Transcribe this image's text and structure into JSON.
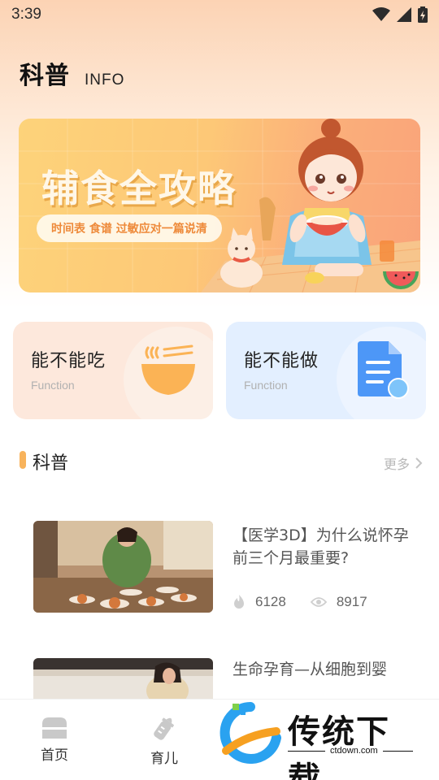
{
  "status": {
    "time": "3:39"
  },
  "header": {
    "title": "科普",
    "subtitle": "INFO"
  },
  "banner": {
    "title": "辅食全攻略",
    "tagline": "时间表 食谱 过敏应对一篇说清"
  },
  "cards": [
    {
      "title": "能不能吃",
      "subtitle": "Function",
      "icon": "noodle-bowl-icon"
    },
    {
      "title": "能不能做",
      "subtitle": "Function",
      "icon": "document-icon"
    }
  ],
  "section": {
    "title": "科普",
    "more": "更多"
  },
  "articles": [
    {
      "title": "【医学3D】为什么说怀孕前三个月最重要?",
      "likes": "6128",
      "views": "8917"
    },
    {
      "title": "生命孕育—从细胞到婴",
      "likes": "",
      "views": ""
    }
  ],
  "tabbar": {
    "tabs": [
      {
        "label": "首页",
        "icon": "home-icon"
      },
      {
        "label": "育儿",
        "icon": "baby-bottle-icon"
      }
    ]
  },
  "watermark": {
    "brand": "传统下载",
    "url": "ctdown.com"
  },
  "colors": {
    "accent": "#f8b35c",
    "banner": "#fdc877",
    "card_eat": "#fde8dc",
    "card_do": "#e3efff"
  }
}
